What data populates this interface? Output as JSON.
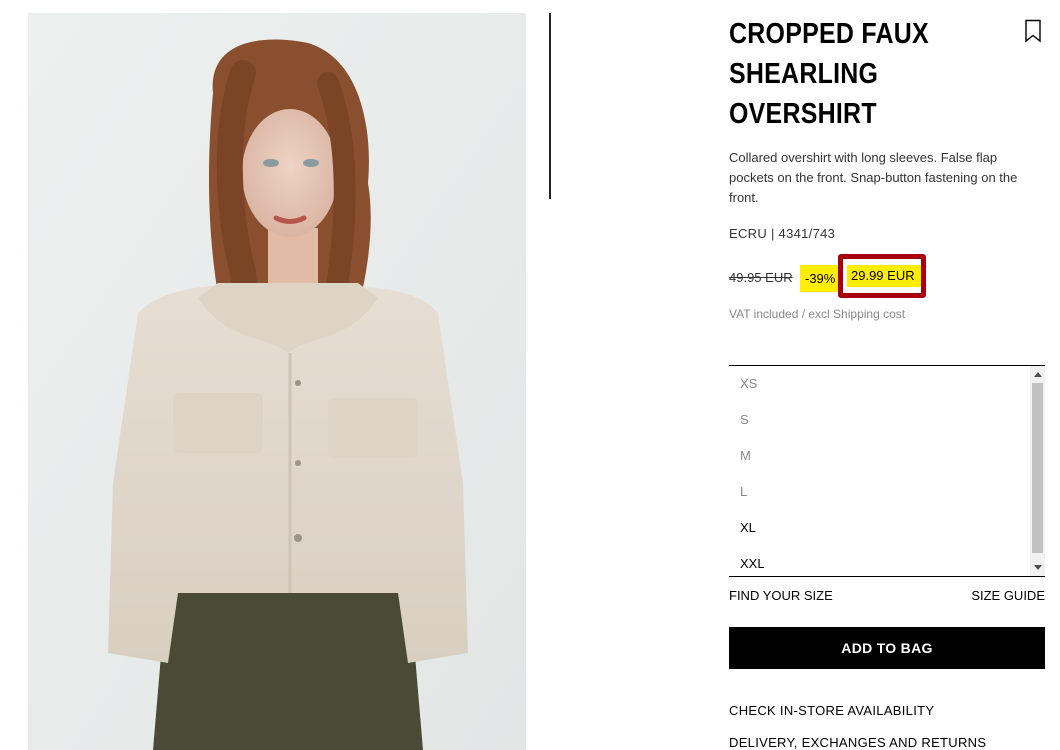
{
  "product": {
    "title": "CROPPED FAUX\nSHEARLING\nOVERSHIRT",
    "description": "Collared overshirt with long sleeves. False flap pockets on the front. Snap-button fastening on the front.",
    "color_ref": "ECRU | 4341/743",
    "old_price": "49.95 EUR",
    "discount": "-39%",
    "new_price": "29.99 EUR",
    "vat_note": "VAT included / excl Shipping cost"
  },
  "sizes": [
    {
      "label": "XS",
      "available": false
    },
    {
      "label": "S",
      "available": false
    },
    {
      "label": "M",
      "available": false
    },
    {
      "label": "L",
      "available": false
    },
    {
      "label": "XL",
      "available": true
    },
    {
      "label": "XXL",
      "available": true
    }
  ],
  "links": {
    "find_size": "FIND YOUR SIZE",
    "size_guide": "SIZE GUIDE",
    "add_to_bag": "ADD TO BAG",
    "check_store": "CHECK IN-STORE AVAILABILITY",
    "delivery": "DELIVERY, EXCHANGES AND RETURNS"
  },
  "icons": {
    "bookmark": "bookmark-icon",
    "scroll_up": "scroll-up-arrow",
    "scroll_down": "scroll-down-arrow"
  },
  "colors": {
    "price_highlight": "#ffee00",
    "annotation_box": "#a8000c",
    "button_bg": "#000000"
  }
}
